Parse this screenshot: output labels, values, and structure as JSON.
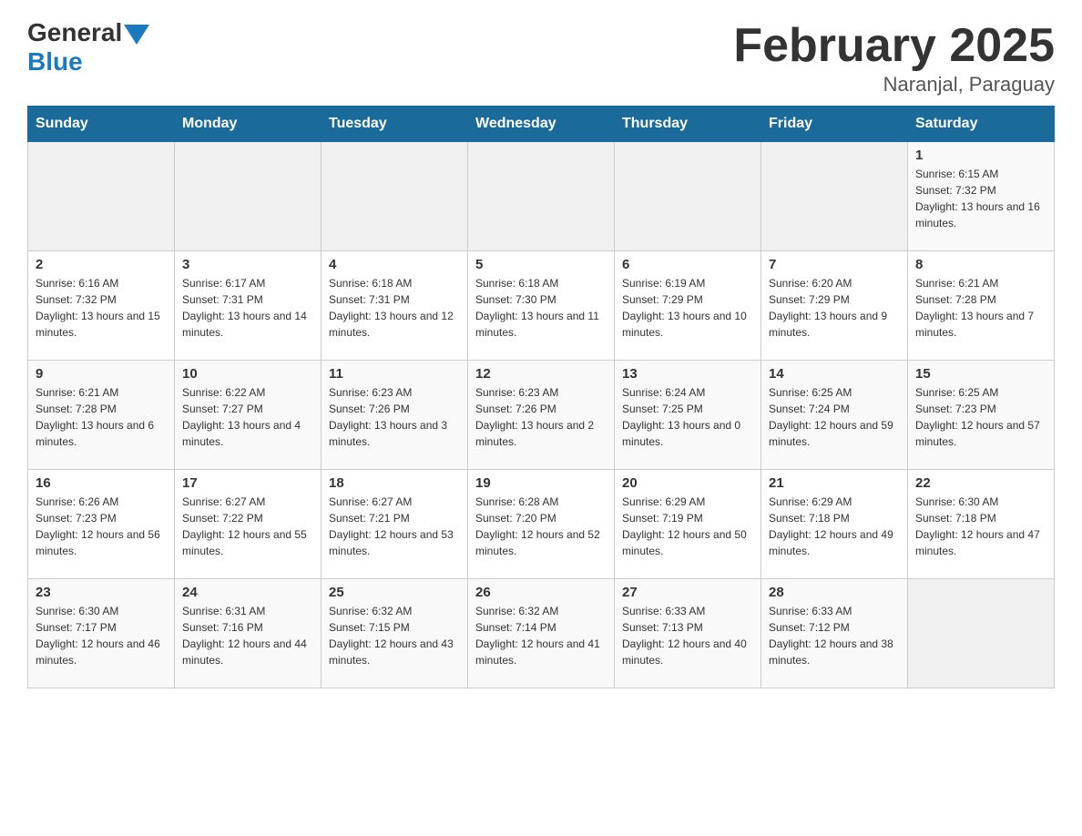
{
  "header": {
    "logo_general": "General",
    "logo_blue": "Blue",
    "title": "February 2025",
    "subtitle": "Naranjal, Paraguay"
  },
  "days_of_week": [
    "Sunday",
    "Monday",
    "Tuesday",
    "Wednesday",
    "Thursday",
    "Friday",
    "Saturday"
  ],
  "weeks": [
    [
      {
        "day": "",
        "info": ""
      },
      {
        "day": "",
        "info": ""
      },
      {
        "day": "",
        "info": ""
      },
      {
        "day": "",
        "info": ""
      },
      {
        "day": "",
        "info": ""
      },
      {
        "day": "",
        "info": ""
      },
      {
        "day": "1",
        "info": "Sunrise: 6:15 AM\nSunset: 7:32 PM\nDaylight: 13 hours and 16 minutes."
      }
    ],
    [
      {
        "day": "2",
        "info": "Sunrise: 6:16 AM\nSunset: 7:32 PM\nDaylight: 13 hours and 15 minutes."
      },
      {
        "day": "3",
        "info": "Sunrise: 6:17 AM\nSunset: 7:31 PM\nDaylight: 13 hours and 14 minutes."
      },
      {
        "day": "4",
        "info": "Sunrise: 6:18 AM\nSunset: 7:31 PM\nDaylight: 13 hours and 12 minutes."
      },
      {
        "day": "5",
        "info": "Sunrise: 6:18 AM\nSunset: 7:30 PM\nDaylight: 13 hours and 11 minutes."
      },
      {
        "day": "6",
        "info": "Sunrise: 6:19 AM\nSunset: 7:29 PM\nDaylight: 13 hours and 10 minutes."
      },
      {
        "day": "7",
        "info": "Sunrise: 6:20 AM\nSunset: 7:29 PM\nDaylight: 13 hours and 9 minutes."
      },
      {
        "day": "8",
        "info": "Sunrise: 6:21 AM\nSunset: 7:28 PM\nDaylight: 13 hours and 7 minutes."
      }
    ],
    [
      {
        "day": "9",
        "info": "Sunrise: 6:21 AM\nSunset: 7:28 PM\nDaylight: 13 hours and 6 minutes."
      },
      {
        "day": "10",
        "info": "Sunrise: 6:22 AM\nSunset: 7:27 PM\nDaylight: 13 hours and 4 minutes."
      },
      {
        "day": "11",
        "info": "Sunrise: 6:23 AM\nSunset: 7:26 PM\nDaylight: 13 hours and 3 minutes."
      },
      {
        "day": "12",
        "info": "Sunrise: 6:23 AM\nSunset: 7:26 PM\nDaylight: 13 hours and 2 minutes."
      },
      {
        "day": "13",
        "info": "Sunrise: 6:24 AM\nSunset: 7:25 PM\nDaylight: 13 hours and 0 minutes."
      },
      {
        "day": "14",
        "info": "Sunrise: 6:25 AM\nSunset: 7:24 PM\nDaylight: 12 hours and 59 minutes."
      },
      {
        "day": "15",
        "info": "Sunrise: 6:25 AM\nSunset: 7:23 PM\nDaylight: 12 hours and 57 minutes."
      }
    ],
    [
      {
        "day": "16",
        "info": "Sunrise: 6:26 AM\nSunset: 7:23 PM\nDaylight: 12 hours and 56 minutes."
      },
      {
        "day": "17",
        "info": "Sunrise: 6:27 AM\nSunset: 7:22 PM\nDaylight: 12 hours and 55 minutes."
      },
      {
        "day": "18",
        "info": "Sunrise: 6:27 AM\nSunset: 7:21 PM\nDaylight: 12 hours and 53 minutes."
      },
      {
        "day": "19",
        "info": "Sunrise: 6:28 AM\nSunset: 7:20 PM\nDaylight: 12 hours and 52 minutes."
      },
      {
        "day": "20",
        "info": "Sunrise: 6:29 AM\nSunset: 7:19 PM\nDaylight: 12 hours and 50 minutes."
      },
      {
        "day": "21",
        "info": "Sunrise: 6:29 AM\nSunset: 7:18 PM\nDaylight: 12 hours and 49 minutes."
      },
      {
        "day": "22",
        "info": "Sunrise: 6:30 AM\nSunset: 7:18 PM\nDaylight: 12 hours and 47 minutes."
      }
    ],
    [
      {
        "day": "23",
        "info": "Sunrise: 6:30 AM\nSunset: 7:17 PM\nDaylight: 12 hours and 46 minutes."
      },
      {
        "day": "24",
        "info": "Sunrise: 6:31 AM\nSunset: 7:16 PM\nDaylight: 12 hours and 44 minutes."
      },
      {
        "day": "25",
        "info": "Sunrise: 6:32 AM\nSunset: 7:15 PM\nDaylight: 12 hours and 43 minutes."
      },
      {
        "day": "26",
        "info": "Sunrise: 6:32 AM\nSunset: 7:14 PM\nDaylight: 12 hours and 41 minutes."
      },
      {
        "day": "27",
        "info": "Sunrise: 6:33 AM\nSunset: 7:13 PM\nDaylight: 12 hours and 40 minutes."
      },
      {
        "day": "28",
        "info": "Sunrise: 6:33 AM\nSunset: 7:12 PM\nDaylight: 12 hours and 38 minutes."
      },
      {
        "day": "",
        "info": ""
      }
    ]
  ]
}
